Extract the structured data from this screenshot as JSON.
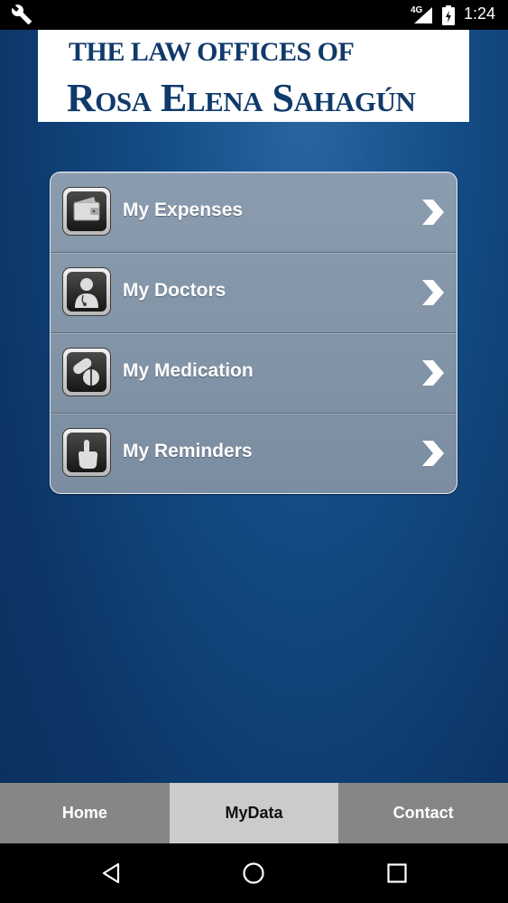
{
  "status_bar": {
    "network": "4G",
    "time": "1:24"
  },
  "header": {
    "line1": "THE LAW OFFICES OF",
    "line2": "Rosa Elena Sahagún"
  },
  "menu": {
    "items": [
      {
        "label": "My Expenses",
        "icon": "wallet-icon"
      },
      {
        "label": "My Doctors",
        "icon": "doctor-icon"
      },
      {
        "label": "My Medication",
        "icon": "pills-icon"
      },
      {
        "label": "My Reminders",
        "icon": "touch-hand-icon"
      }
    ]
  },
  "tabs": [
    {
      "label": "Home",
      "active": false
    },
    {
      "label": "MyData",
      "active": true
    },
    {
      "label": "Contact",
      "active": false
    }
  ],
  "colors": {
    "banner_text": "#0f3a6a",
    "tab_active": "#cbcbcb",
    "tab_inactive": "#868686"
  }
}
